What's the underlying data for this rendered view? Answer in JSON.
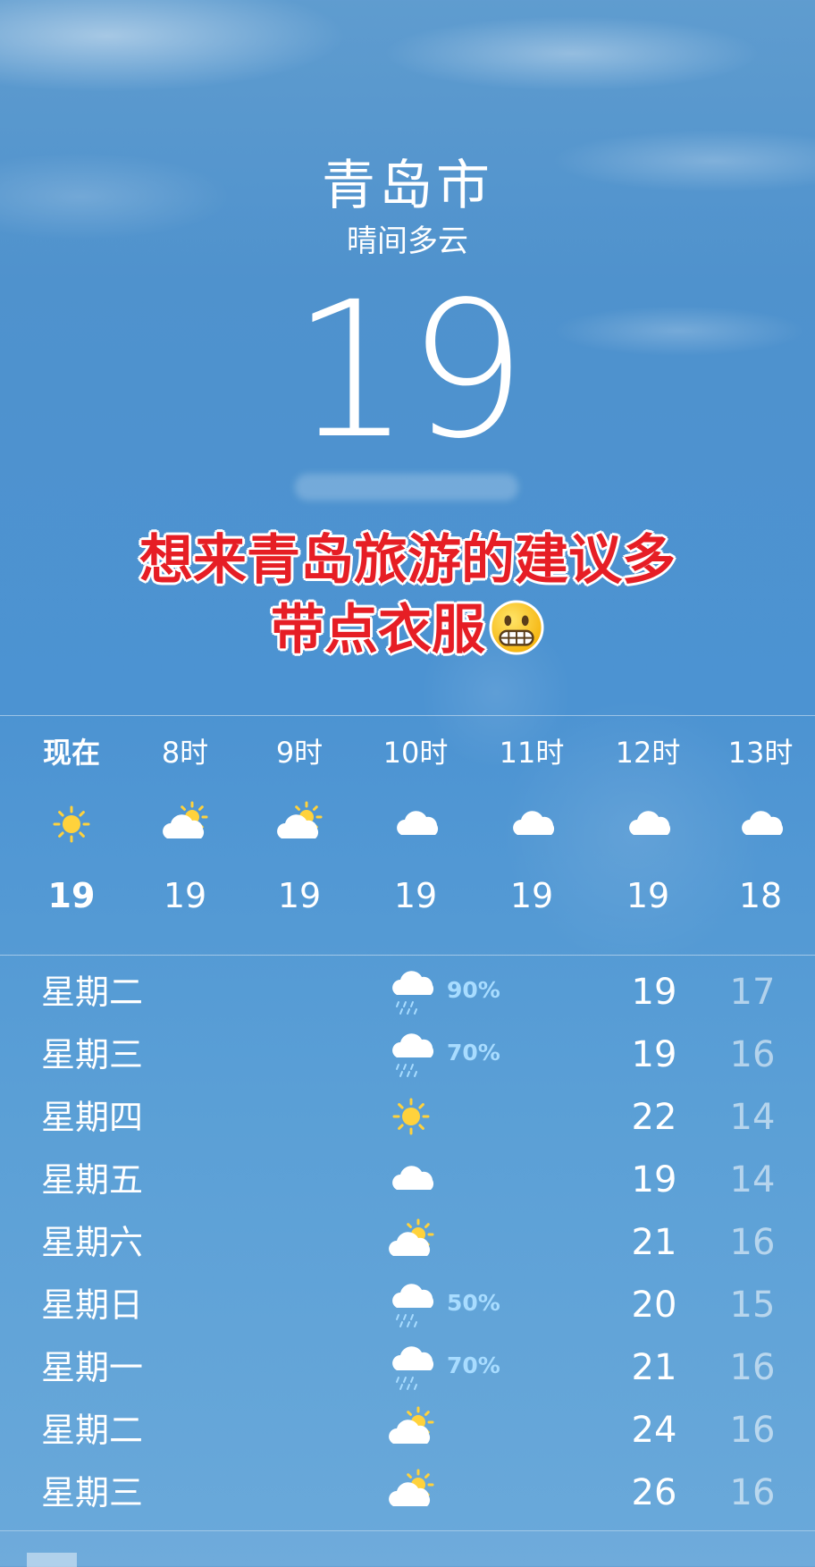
{
  "location": {
    "city": "青岛市",
    "condition": "晴间多云",
    "temperature": "19"
  },
  "caption": {
    "line1": "想来青岛旅游的建议多",
    "line2": "带点衣服",
    "emoji": "grimacing-face-emoji"
  },
  "hourly": [
    {
      "label": "现在",
      "icon": "sun-icon",
      "temp": "19"
    },
    {
      "label": "8时",
      "icon": "partly-sunny-icon",
      "temp": "19"
    },
    {
      "label": "9时",
      "icon": "partly-sunny-icon",
      "temp": "19"
    },
    {
      "label": "10时",
      "icon": "cloud-icon",
      "temp": "19"
    },
    {
      "label": "11时",
      "icon": "cloud-icon",
      "temp": "19"
    },
    {
      "label": "12时",
      "icon": "cloud-icon",
      "temp": "19"
    },
    {
      "label": "13时",
      "icon": "cloud-icon",
      "temp": "18"
    }
  ],
  "daily": [
    {
      "day": "星期二",
      "icon": "rain-icon",
      "precip": "90%",
      "high": "19",
      "low": "17"
    },
    {
      "day": "星期三",
      "icon": "rain-icon",
      "precip": "70%",
      "high": "19",
      "low": "16"
    },
    {
      "day": "星期四",
      "icon": "sun-icon",
      "precip": "",
      "high": "22",
      "low": "14"
    },
    {
      "day": "星期五",
      "icon": "cloud-icon",
      "precip": "",
      "high": "19",
      "low": "14"
    },
    {
      "day": "星期六",
      "icon": "partly-sunny-icon",
      "precip": "",
      "high": "21",
      "low": "16"
    },
    {
      "day": "星期日",
      "icon": "rain-icon",
      "precip": "50%",
      "high": "20",
      "low": "15"
    },
    {
      "day": "星期一",
      "icon": "rain-icon",
      "precip": "70%",
      "high": "21",
      "low": "16"
    },
    {
      "day": "星期二",
      "icon": "partly-sunny-icon",
      "precip": "",
      "high": "24",
      "low": "16"
    },
    {
      "day": "星期三",
      "icon": "partly-sunny-icon",
      "precip": "",
      "high": "26",
      "low": "16"
    }
  ],
  "colors": {
    "sun": "#ffd23c",
    "cloud": "#ffffff",
    "precip": "#a8dcff",
    "caption": "#e61e25"
  }
}
